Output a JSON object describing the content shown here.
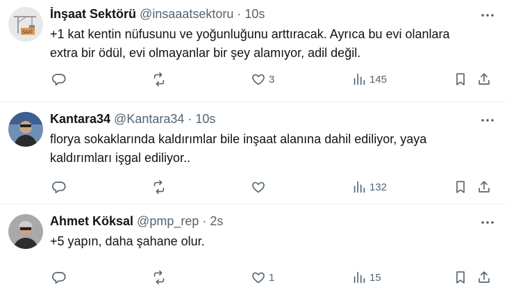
{
  "tweets": [
    {
      "name": "İnşaat Sektörü",
      "handle": "@insaaatsektoru",
      "separator": "·",
      "time": "10s",
      "text_lines": [
        "+1 kat kentin nüfusunu ve yoğunluğunu arttıracak. Ayrıca bu evi olanlara",
        "extra bir ödül, evi olmayanlar bir şey alamıyor, adil değil."
      ],
      "likes": "3",
      "views": "145",
      "avatar_icon": "crane-logo-avatar"
    },
    {
      "name": "Kantara34",
      "handle": "@Kantara34",
      "separator": "·",
      "time": "10s",
      "text_lines": [
        "florya sokaklarında kaldırımlar bile inşaat alanına dahil ediliyor, yaya",
        "kaldırımları işgal ediliyor.."
      ],
      "likes": "",
      "views": "132",
      "avatar_icon": "person-photo-avatar"
    },
    {
      "name": "Ahmet Köksal",
      "handle": "@pmp_rep",
      "separator": "·",
      "time": "2s",
      "text_lines": [
        "+5 yapın, daha şahane olur."
      ],
      "likes": "1",
      "views": "15",
      "avatar_icon": "person-photo-avatar"
    }
  ],
  "colors": {
    "text": "#0f1419",
    "secondary": "#536471",
    "divider": "#eff3f4",
    "background": "#ffffff"
  }
}
